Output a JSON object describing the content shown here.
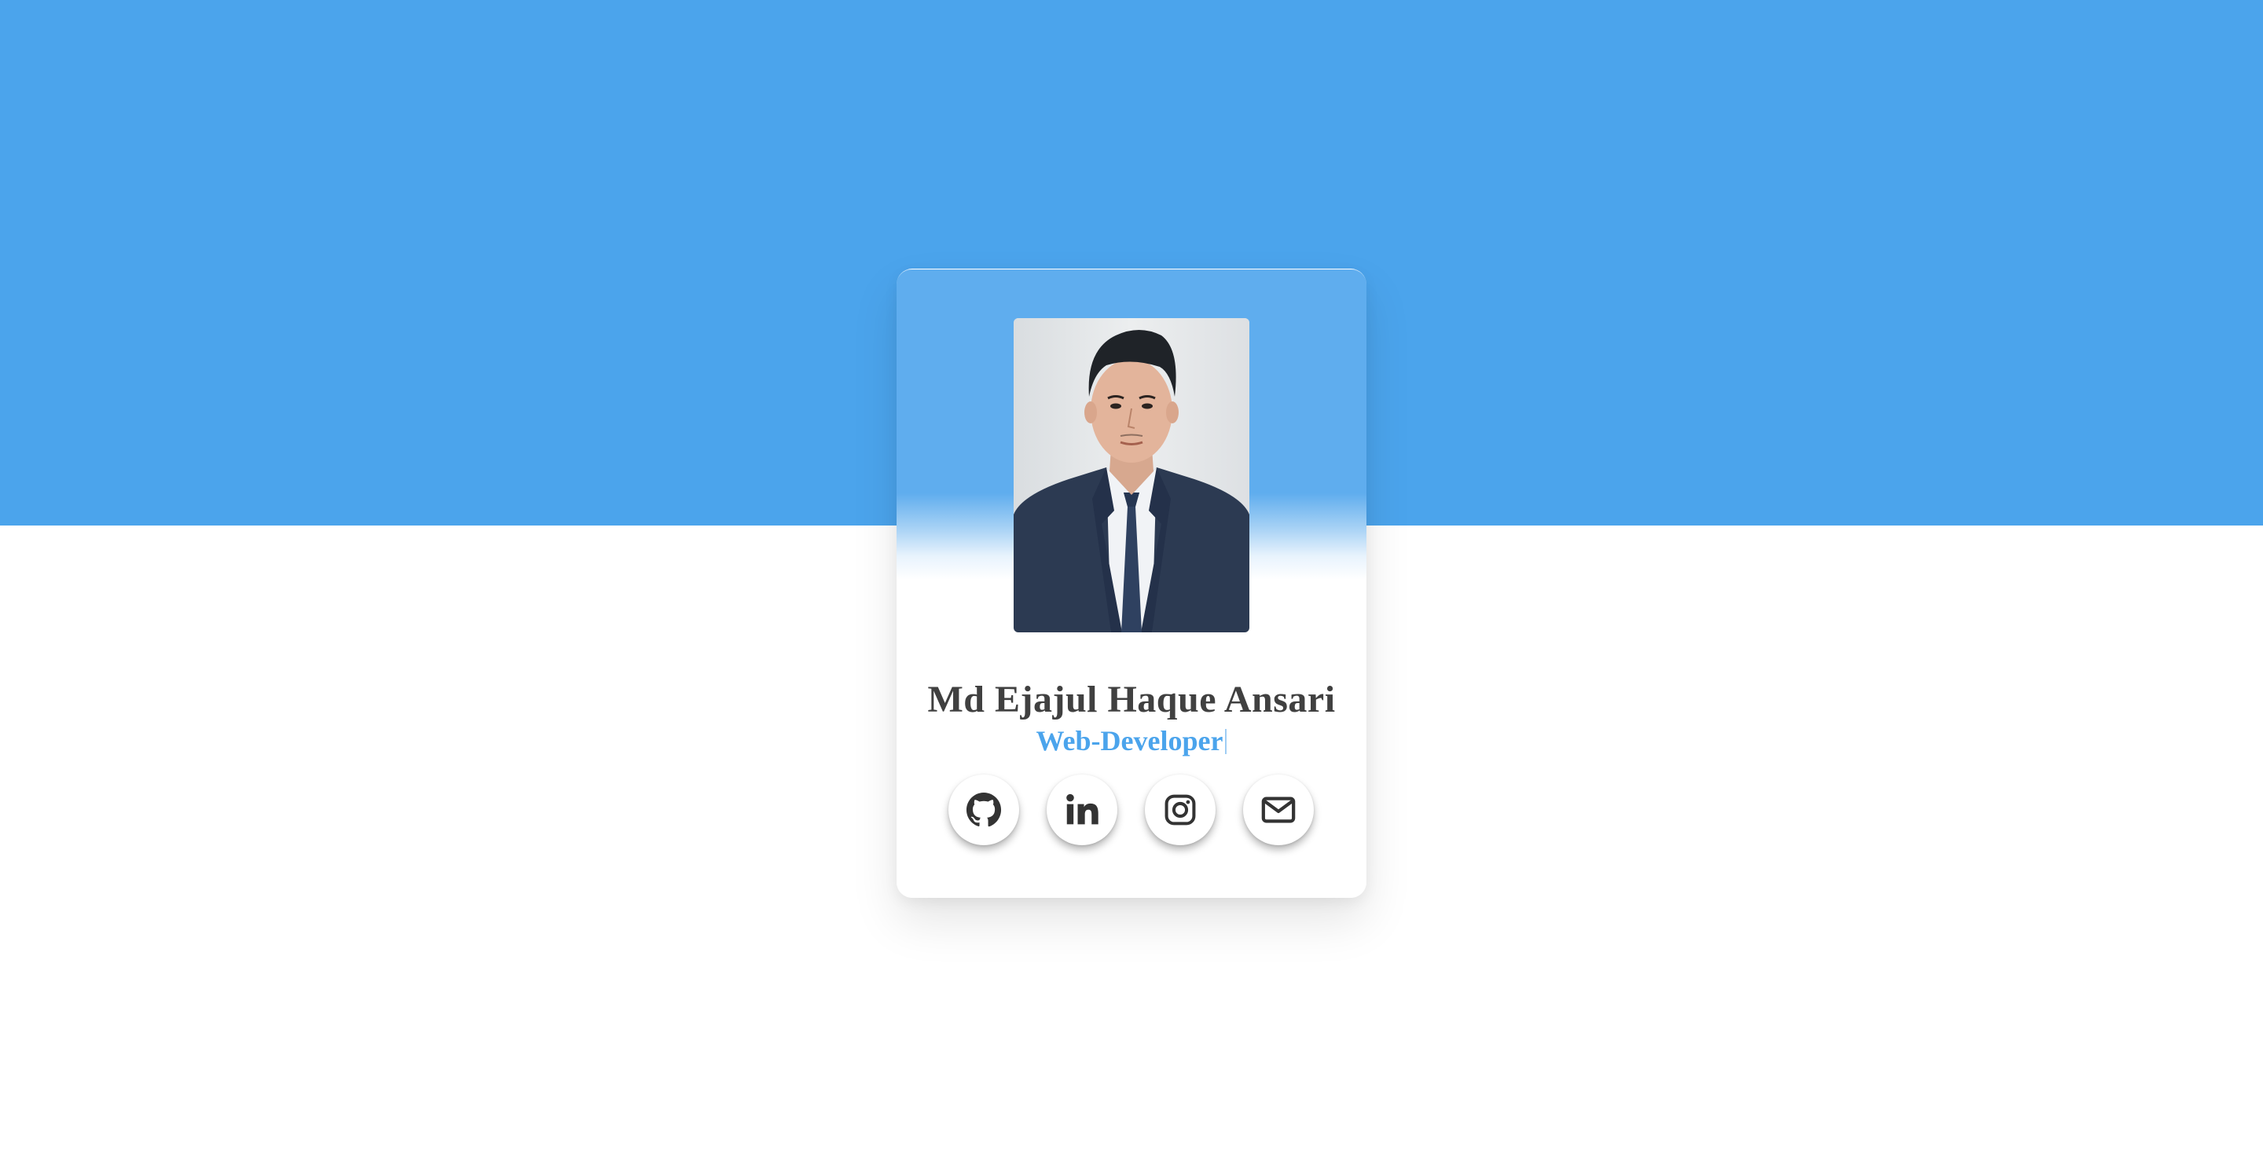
{
  "profile": {
    "name": "Md Ejajul Haque Ansari",
    "role": "Web-Developer"
  },
  "socials": [
    {
      "icon": "github-icon"
    },
    {
      "icon": "linkedin-icon"
    },
    {
      "icon": "instagram-icon"
    },
    {
      "icon": "envelope-icon"
    }
  ],
  "colors": {
    "accent": "#4ba4ec",
    "text": "#404040",
    "background": "#ffffff"
  }
}
